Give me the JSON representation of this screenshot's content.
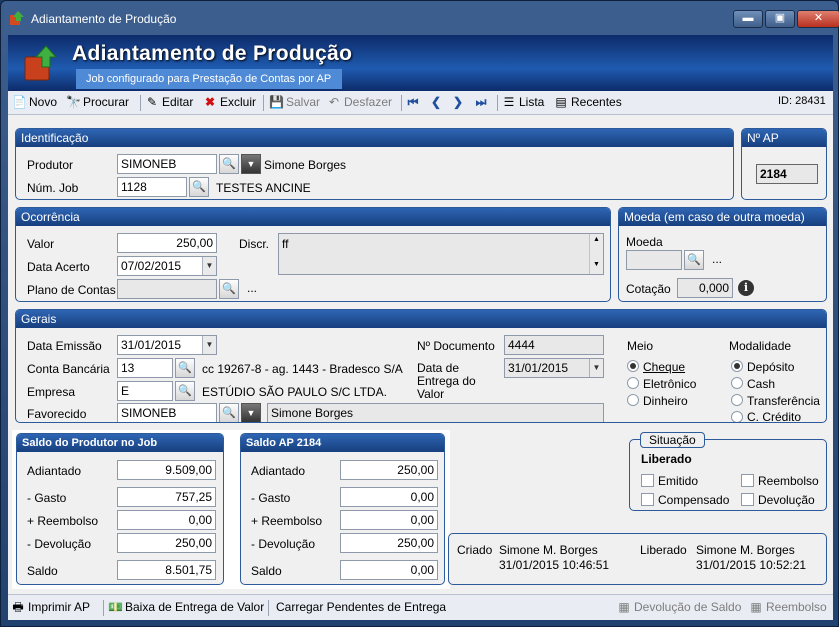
{
  "window": {
    "title": "Adiantamento de Produção"
  },
  "header": {
    "title": "Adiantamento de Produção",
    "subtitle": "Job configurado para Prestação de Contas por AP"
  },
  "toolbar": {
    "novo": "Novo",
    "procurar": "Procurar",
    "editar": "Editar",
    "excluir": "Excluir",
    "salvar": "Salvar",
    "desfazer": "Desfazer",
    "lista": "Lista",
    "recentes": "Recentes",
    "id_label": "ID: 28431"
  },
  "identificacao": {
    "title": "Identificação",
    "produtor_label": "Produtor",
    "produtor_value": "SIMONEB",
    "produtor_name": "Simone Borges",
    "job_label": "Núm. Job",
    "job_value": "1128",
    "job_name": "TESTES ANCINE"
  },
  "nap": {
    "title": "Nº AP",
    "value": "2184"
  },
  "ocorrencia": {
    "title": "Ocorrência",
    "valor_label": "Valor",
    "valor_value": "250,00",
    "data_label": "Data Acerto",
    "data_value": "07/02/2015",
    "plano_label": "Plano de Contas",
    "plano_ellipsis": "...",
    "discr_label": "Discr.",
    "discr_value": "ff"
  },
  "moeda": {
    "title": "Moeda (em caso de outra moeda)",
    "moeda_label": "Moeda",
    "moeda_ellipsis": "...",
    "cotacao_label": "Cotação",
    "cotacao_value": "0,000"
  },
  "gerais": {
    "title": "Gerais",
    "emissao_label": "Data Emissão",
    "emissao_value": "31/01/2015",
    "conta_label": "Conta Bancária",
    "conta_value": "13",
    "conta_desc": "cc 19267-8 - ag. 1443  - Bradesco S/A",
    "empresa_label": "Empresa",
    "empresa_value": "E",
    "empresa_desc": "ESTÚDIO SÃO PAULO S/C LTDA.",
    "favorecido_label": "Favorecido",
    "favorecido_value": "SIMONEB",
    "favorecido_name": "Simone Borges",
    "documento_label": "Nº Documento",
    "documento_value": "4444",
    "entrega_label": "Data de Entrega do Valor",
    "entrega_value": "31/01/2015",
    "meio_label": "Meio",
    "meio_options": [
      "Cheque",
      "Eletrônico",
      "Dinheiro"
    ],
    "modalidade_label": "Modalidade",
    "modalidade_options": [
      "Depósito",
      "Cash",
      "Transferência",
      "C. Crédito"
    ]
  },
  "saldo_produtor": {
    "title": "Saldo do Produtor no Job",
    "rows": [
      {
        "label": "Adiantado",
        "value": "9.509,00"
      },
      {
        "label": "- Gasto",
        "value": "757,25"
      },
      {
        "label": "+ Reembolso",
        "value": "0,00"
      },
      {
        "label": "- Devolução",
        "value": "250,00"
      },
      {
        "label": "Saldo",
        "value": "8.501,75"
      }
    ]
  },
  "saldo_ap": {
    "title": "Saldo AP 2184",
    "rows": [
      {
        "label": "Adiantado",
        "value": "250,00"
      },
      {
        "label": "- Gasto",
        "value": "0,00"
      },
      {
        "label": "+ Reembolso",
        "value": "0,00"
      },
      {
        "label": "- Devolução",
        "value": "250,00"
      },
      {
        "label": "Saldo",
        "value": "0,00"
      }
    ]
  },
  "situacao": {
    "title": "Situação",
    "status": "Liberado",
    "options": [
      "Emitido",
      "Reembolso",
      "Compensado",
      "Devolução"
    ]
  },
  "audit": {
    "criado_label": "Criado",
    "criado_user": "Simone M. Borges",
    "criado_date": "31/01/2015 10:46:51",
    "liberado_label": "Liberado",
    "liberado_user": "Simone M. Borges",
    "liberado_date": "31/01/2015 10:52:21"
  },
  "bottom": {
    "imprimir": "Imprimir AP",
    "baixa": "Baixa de Entrega de Valor",
    "carregar": "Carregar Pendentes de Entrega",
    "devolucao": "Devolução de Saldo",
    "reembolso": "Reembolso"
  }
}
